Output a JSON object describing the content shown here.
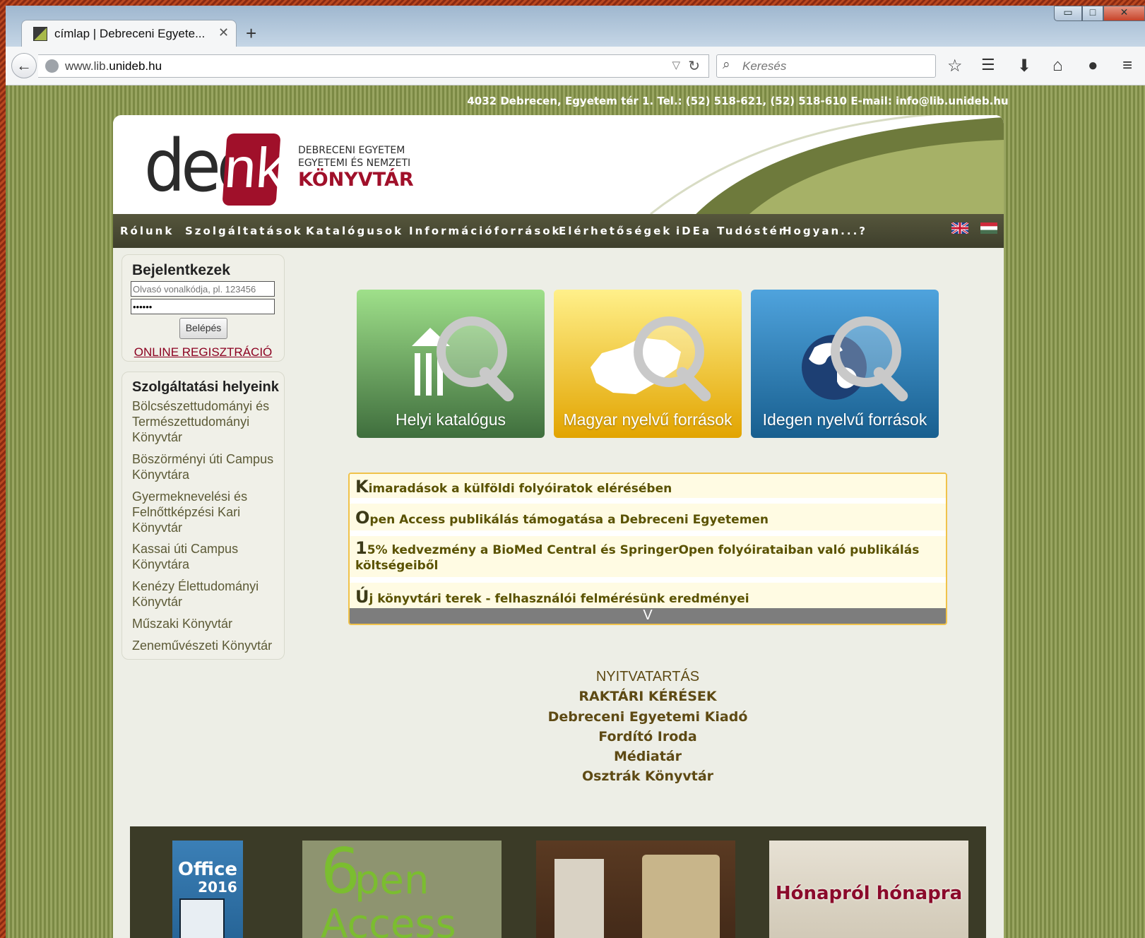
{
  "browser": {
    "tab_title": "címlap | Debreceni Egyete...",
    "tab_close": "✕",
    "new_tab": "+",
    "url_prefix": "www.lib.",
    "url_domain": "unideb.hu",
    "search_placeholder": "Keresés",
    "window_controls": [
      "▭",
      "□",
      "✕"
    ],
    "toolbar_icons": [
      "star-icon",
      "reading-list-icon",
      "download-icon",
      "home-icon",
      "chat-icon",
      "menu-icon"
    ]
  },
  "site": {
    "address_line": "4032 Debrecen, Egyetem tér 1. Tel.: (52) 518-621, (52) 518-610 E-mail: info@lib.unideb.hu",
    "logo": {
      "dee": "dee",
      "nk": "nk",
      "line1": "DEBRECENI EGYETEM",
      "line2": "EGYETEMI ÉS NEMZETI",
      "line3": "KÖNYVTÁR"
    },
    "menu": [
      "Rólunk",
      "Szolgáltatások",
      "Katalógusok",
      "Információforrások",
      "Elérhetőségek",
      "iDEa Tudóstér",
      "Hogyan...?"
    ],
    "login": {
      "title": "Bejelentkezek",
      "barcode_placeholder": "Olvasó vonalkódja, pl. 123456",
      "password_value": "••••••",
      "button": "Belépés",
      "register_link": "ONLINE REGISZTRÁCIÓ"
    },
    "places": {
      "title": "Szolgáltatási helyeink",
      "items": [
        "Bölcsészettudományi és Természettudományi Könyvtár",
        "Böszörményi úti Campus Könyvtára",
        "Gyermeknevelési és Felnőttképzési Kari Könyvtár",
        "Kassai úti Campus Könyvtára",
        "Kenézy Élettudományi Könyvtár",
        "Műszaki Könyvtár",
        "Zeneművészeti Könyvtár"
      ]
    },
    "tiles": [
      {
        "label": "Helyi katalógus",
        "color_top": "#9fe08a",
        "color_bottom": "#3f6e3d"
      },
      {
        "label": "Magyar nyelvű források",
        "color_top": "#fff08a",
        "color_bottom": "#e2a400"
      },
      {
        "label": "Idegen nyelvű források",
        "color_top": "#4fa3dd",
        "color_bottom": "#185f8f"
      }
    ],
    "news": [
      {
        "cap": "K",
        "rest": "imaradások a külföldi folyóiratok elérésében"
      },
      {
        "cap": "O",
        "rest": "pen Access publikálás támogatása a Debreceni Egyetemen"
      },
      {
        "cap": "1",
        "rest": "5% kedvezmény a BioMed Central és SpringerOpen folyóirataiban való publikálás költségeiből"
      },
      {
        "cap": "Ú",
        "rest": "j könyvtári terek - felhasználói felmérésünk eredményei"
      }
    ],
    "news_more": "V",
    "links": [
      "NYITVATARTÁS",
      "RAKTÁRI KÉRÉSEK",
      "Debreceni Egyetemi Kiadó",
      "Fordító Iroda",
      "Médiatár",
      "Osztrák Könyvtár"
    ],
    "footer": {
      "office_title": "Office",
      "office_year": "2016",
      "open_access_num": "6",
      "open_access_word": "pen",
      "open_access_word2": "Access",
      "monthly": "Hónapról hónapra"
    }
  }
}
